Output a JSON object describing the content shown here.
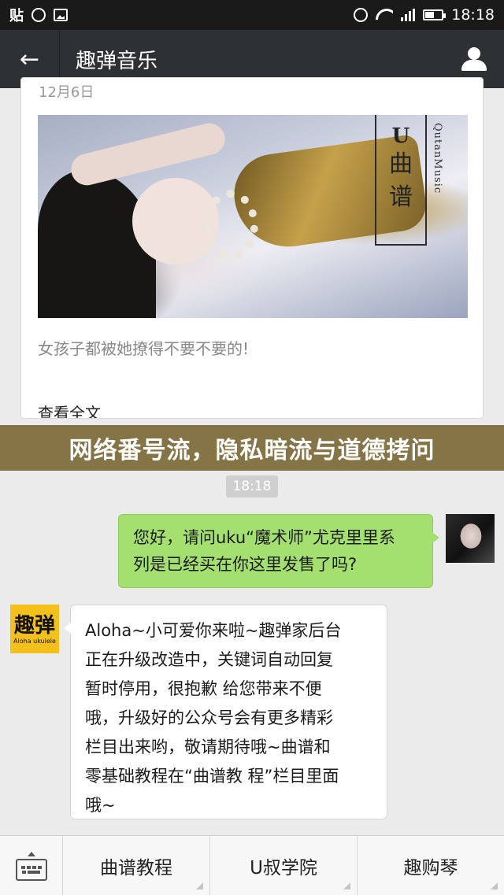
{
  "status_bar": {
    "left_text": "贴",
    "time": "18:18"
  },
  "nav": {
    "back_icon": "←",
    "title": "趣弹音乐"
  },
  "article": {
    "date": "12月6日",
    "image_badge": {
      "letter": "U",
      "line1": "曲",
      "line2": "谱",
      "side_text": "QutanMusic"
    },
    "description": "女孩子都被她撩得不要不要的!",
    "read_more": "查看全文"
  },
  "overlay_banner": "网络番号流，隐私暗流与道德拷问",
  "chat": {
    "time": "18:18",
    "outgoing": {
      "lines": [
        "您好，请问uku“魔术师”尤克里里系",
        "列是已经买在你这里发售了吗?"
      ]
    },
    "incoming": {
      "avatar_name": "趣弹",
      "avatar_sub": "Aloha ukulele",
      "lines": [
        "Aloha~小可爱你来啦~趣弹家后台",
        "正在升级改造中，关键词自动回复",
        "暂时停用，很抱歉 给您带来不便",
        "哦，升级好的公众号会有更多精彩",
        "栏目出来哟，敬请期待哦~曲谱和",
        "零基础教程在“曲谱教 程”栏目里面",
        "哦~"
      ]
    }
  },
  "bottom_menu": {
    "items": [
      "曲谱教程",
      "U叔学院",
      "趣购琴"
    ]
  },
  "colors": {
    "nav_bg": "#2e3134",
    "outgoing_bubble": "#a4e070",
    "banner_bg": "#7d6a38",
    "avatar_bot_bg": "#f4c11b"
  }
}
